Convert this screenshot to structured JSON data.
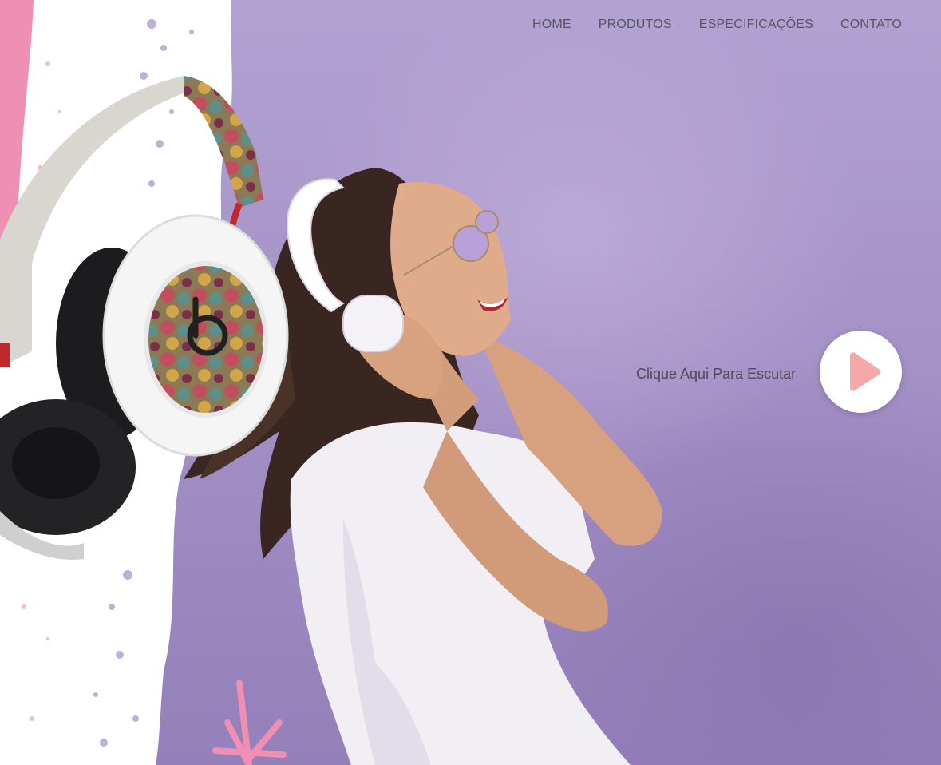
{
  "nav": {
    "items": [
      {
        "label": "HOME"
      },
      {
        "label": "PRODUTOS"
      },
      {
        "label": "ESPECIFICAÇÕES"
      },
      {
        "label": "CONTATO"
      }
    ]
  },
  "hero": {
    "cta_label": "Clique Aqui Para Escutar",
    "play_icon": "play-icon",
    "photo": "woman-wearing-white-headphones",
    "product": "beats-headphones-patterned"
  },
  "colors": {
    "background": "#a895c8",
    "splash_pink": "#ef8fb3",
    "nav_text": "#555566",
    "cta_text": "#4e4a57",
    "play_button_bg": "#ffffff",
    "play_icon_fill": "#f6a7a9"
  }
}
